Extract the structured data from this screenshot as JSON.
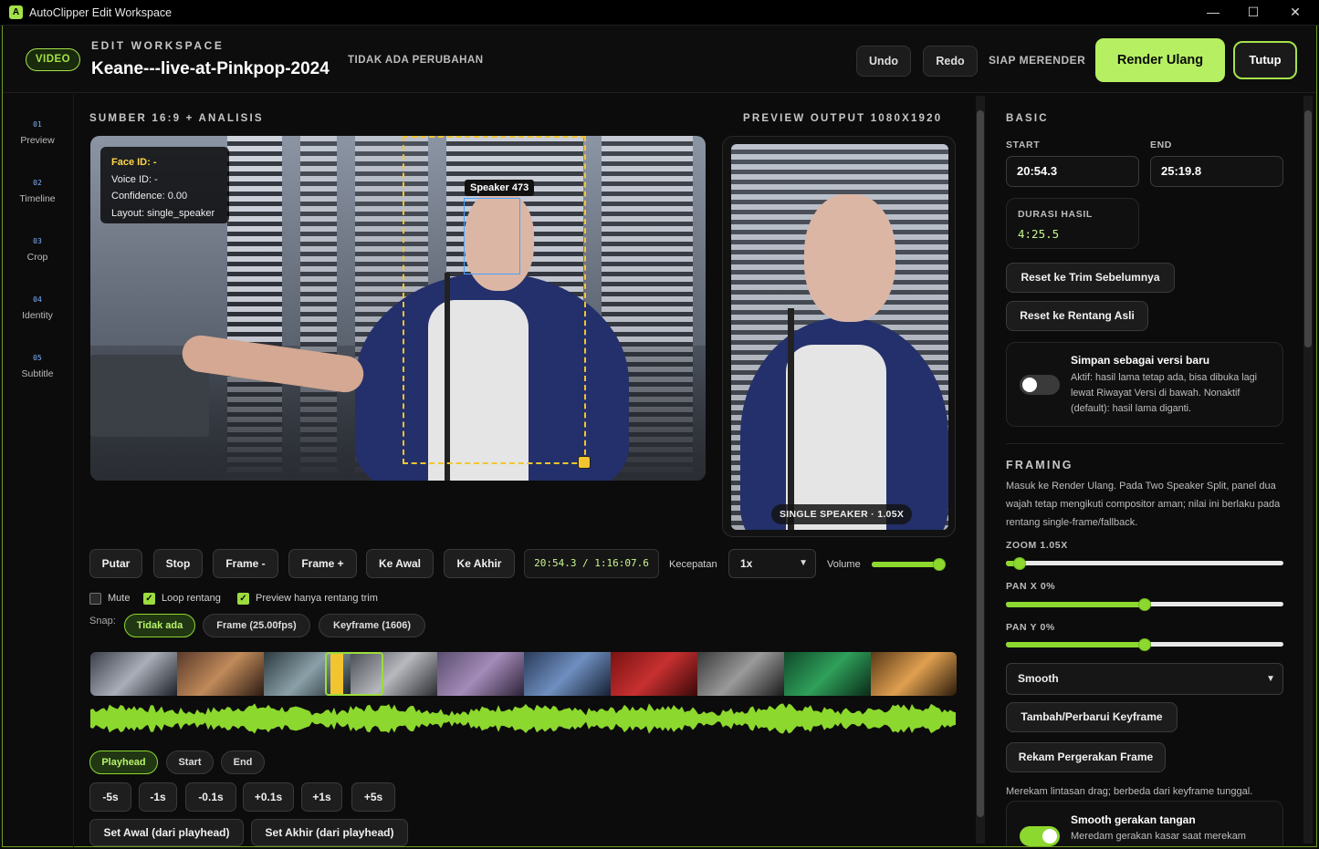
{
  "window": {
    "title": "AutoClipper Edit Workspace",
    "minimize": "—",
    "maximize": "☐",
    "close": "✕"
  },
  "header": {
    "badge": "VIDEO",
    "label": "EDIT WORKSPACE",
    "title": "Keane---live-at-Pinkpop-2024",
    "status": "TIDAK ADA PERUBAHAN",
    "undo": "Undo",
    "redo": "Redo",
    "ready": "SIAP MERENDER",
    "render": "Render Ulang",
    "close": "Tutup"
  },
  "nav": [
    {
      "num": "01",
      "label": "Preview"
    },
    {
      "num": "02",
      "label": "Timeline"
    },
    {
      "num": "03",
      "label": "Crop"
    },
    {
      "num": "04",
      "label": "Identity"
    },
    {
      "num": "05",
      "label": "Subtitle"
    }
  ],
  "source": {
    "label": "SUMBER 16:9 + ANALISIS",
    "info": [
      "Face ID: -",
      "Voice ID: -",
      "Confidence: 0.00",
      "Layout: single_speaker"
    ],
    "speaker_tag": "Speaker 473"
  },
  "preview": {
    "label": "PREVIEW OUTPUT 1080X1920",
    "badge": "SINGLE SPEAKER · 1.05X"
  },
  "controls": {
    "play": "Putar",
    "stop": "Stop",
    "frame_back": "Frame -",
    "frame_fwd": "Frame +",
    "to_start": "Ke Awal",
    "to_end": "Ke Akhir",
    "timecode": "20:54.3 / 1:16:07.6",
    "speed_label": "Kecepatan",
    "speed_value": "1x",
    "volume_label": "Volume",
    "volume": 0.95,
    "mute": "Mute",
    "mute_checked": false,
    "loop": "Loop rentang",
    "loop_checked": true,
    "preview_trim": "Preview hanya rentang trim",
    "preview_trim_checked": true,
    "snap_label": "Snap:",
    "snap_options": [
      "Tidak ada",
      "Frame (25.00fps)",
      "Keyframe (1606)"
    ],
    "snap_selected": "Tidak ada",
    "targets": [
      "Playhead",
      "Start",
      "End"
    ],
    "target_selected": "Playhead",
    "nudges": [
      "-5s",
      "-1s",
      "-0.1s",
      "+0.1s",
      "+1s",
      "+5s"
    ],
    "set_start": "Set Awal (dari playhead)",
    "set_end": "Set Akhir (dari playhead)"
  },
  "panel": {
    "basic_title": "BASIC",
    "start_label": "START",
    "start_value": "20:54.3",
    "end_label": "END",
    "end_value": "25:19.8",
    "duration_label": "DURASI HASIL",
    "duration_value": "4:25.5",
    "reset_trim": "Reset ke Trim Sebelumnya",
    "reset_range": "Reset ke Rentang Asli",
    "save_title": "Simpan sebagai versi baru",
    "save_desc": "Aktif: hasil lama tetap ada, bisa dibuka lagi lewat Riwayat Versi di bawah. Nonaktif (default): hasil lama diganti.",
    "save_on": false,
    "framing_title": "FRAMING",
    "framing_desc": "Masuk ke Render Ulang. Pada Two Speaker Split, panel dua wajah tetap mengikuti compositor aman; nilai ini berlaku pada rentang single-frame/fallback.",
    "zoom_label": "ZOOM 1.05X",
    "zoom": 0.05,
    "panx_label": "PAN X 0%",
    "panx": 0.5,
    "pany_label": "PAN Y 0%",
    "pany": 0.5,
    "easing_value": "Smooth",
    "add_keyframe": "Tambah/Perbarui Keyframe",
    "record_motion": "Rekam Pergerakan Frame",
    "record_desc": "Merekam lintasan drag; berbeda dari keyframe tunggal.",
    "smooth_title": "Smooth gerakan tangan",
    "smooth_desc": "Meredam gerakan kasar saat merekam",
    "smooth_on": true
  },
  "colors": {
    "accent": "#b6f062",
    "crop": "#f2c530",
    "face": "#4aa3ff",
    "wave": "#8cd82e"
  }
}
